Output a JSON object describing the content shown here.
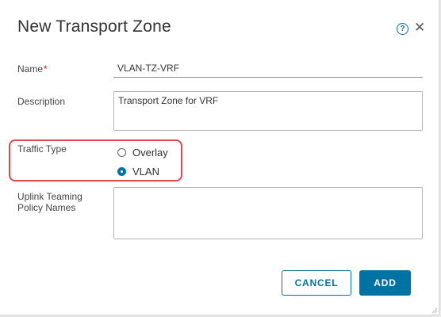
{
  "dialog": {
    "title": "New Transport Zone",
    "help_icon": "help-circle-icon",
    "help_glyph": "?",
    "close_icon": "close-icon",
    "close_glyph": "✕"
  },
  "fields": {
    "name": {
      "label": "Name",
      "required_mark": "*",
      "value": "VLAN-TZ-VRF"
    },
    "description": {
      "label": "Description",
      "value": "Transport Zone for VRF"
    },
    "traffic_type": {
      "label": "Traffic Type",
      "options": [
        {
          "label": "Overlay",
          "selected": false
        },
        {
          "label": "VLAN",
          "selected": true
        }
      ]
    },
    "uplink": {
      "label_line1": "Uplink Teaming",
      "label_line2": "Policy Names",
      "value": ""
    }
  },
  "buttons": {
    "cancel": "CANCEL",
    "add": "ADD"
  },
  "colors": {
    "accent": "#0072a3",
    "highlight": "#e0484b",
    "required": "#c92100"
  }
}
